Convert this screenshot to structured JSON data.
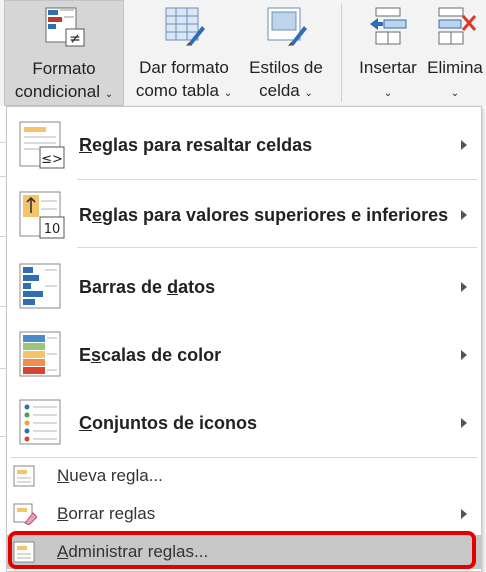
{
  "ribbon": {
    "formato": {
      "line1": "Formato",
      "line2": "condicional",
      "caret": "⌄"
    },
    "dar": {
      "line1": "Dar formato",
      "line2": "como tabla",
      "caret": "⌄"
    },
    "estilos": {
      "line1": "Estilos de",
      "line2": "celda",
      "caret": "⌄"
    },
    "insertar": {
      "line1": "Insertar",
      "caret": "⌄"
    },
    "elimina": {
      "line1": "Elimina",
      "caret": "⌄"
    },
    "ne_glyph": "≠"
  },
  "menu": {
    "items": [
      {
        "label_pre": "",
        "accel": "R",
        "label_post": "eglas para resaltar celdas",
        "icon": "highlight-rules-icon",
        "glyph": "≤>"
      },
      {
        "label_pre": "R",
        "accel": "e",
        "label_post": "glas para valores superiores e inferiores",
        "icon": "top-bottom-rules-icon",
        "glyph": "10"
      },
      {
        "label_pre": "Barras de ",
        "accel": "d",
        "label_post": "atos",
        "icon": "data-bars-icon"
      },
      {
        "label_pre": "E",
        "accel": "s",
        "label_post": "calas de color",
        "icon": "color-scales-icon"
      },
      {
        "label_pre": "",
        "accel": "C",
        "label_post": "onjuntos de iconos",
        "icon": "icon-sets-icon"
      }
    ],
    "small_items": [
      {
        "label_pre": "",
        "accel": "N",
        "label_post": "ueva regla...",
        "icon": "new-rule-icon"
      },
      {
        "label_pre": "",
        "accel": "B",
        "label_post": "orrar reglas",
        "icon": "clear-rules-icon"
      },
      {
        "label_pre": "",
        "accel": "A",
        "label_post": "dministrar reglas...",
        "icon": "manage-rules-icon"
      }
    ]
  },
  "colors": {
    "highlight": "#c7c7c7",
    "red_outline": "#e50000",
    "ribbon_bg": "#f3f3f3"
  }
}
